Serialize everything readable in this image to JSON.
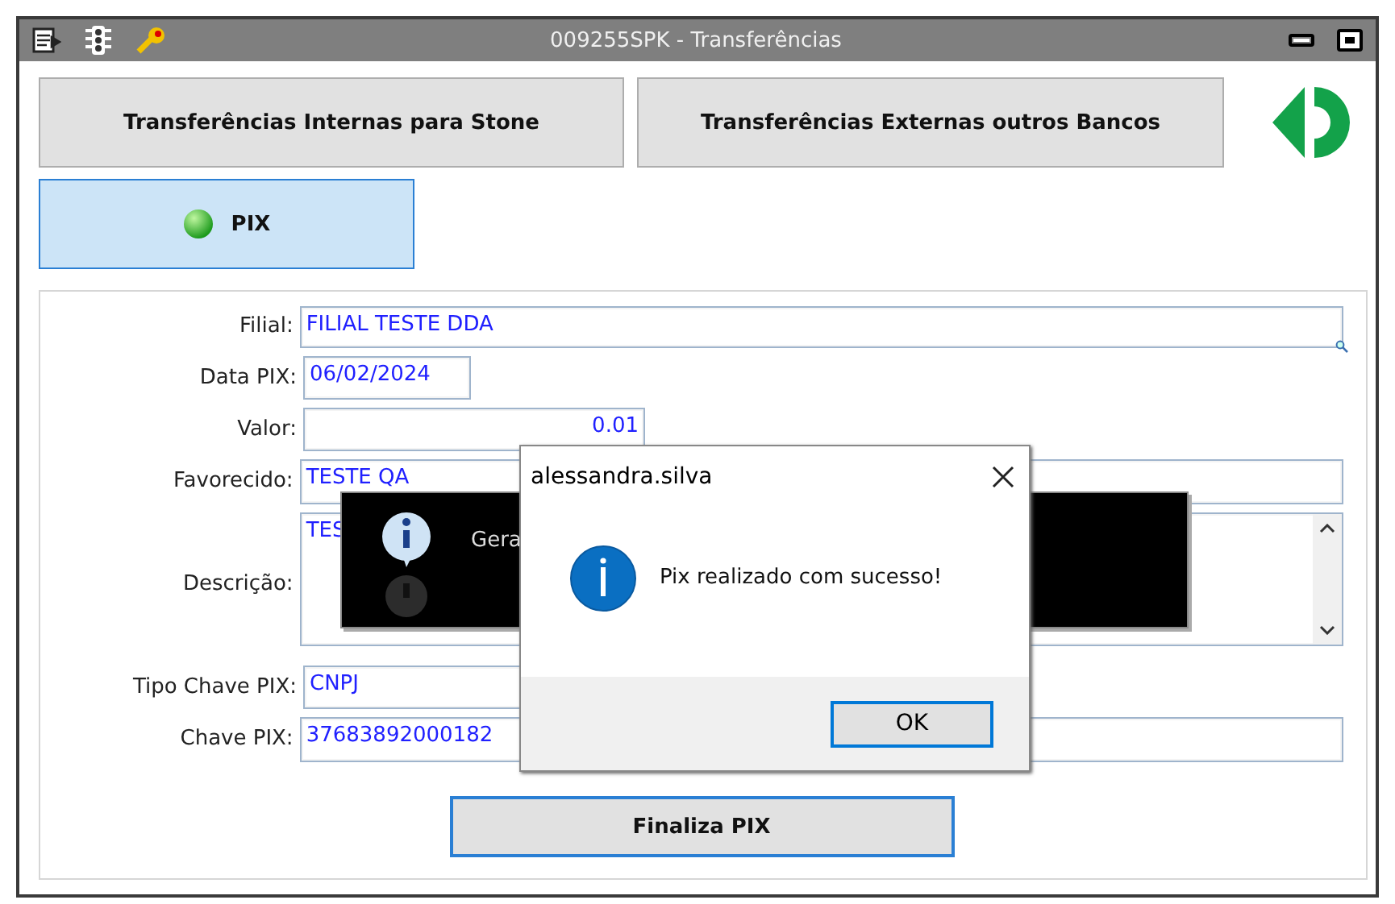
{
  "window": {
    "title": "009255SPK - Transferências"
  },
  "tabs": [
    {
      "label": "Transferências Internas para Stone",
      "selected": false
    },
    {
      "label": "Transferências Externas outros Bancos",
      "selected": false
    },
    {
      "label": "PIX",
      "selected": true
    }
  ],
  "form": {
    "fields": [
      {
        "label": "Filial:",
        "value": "FILIAL TESTE DDA",
        "kind": "lookup"
      },
      {
        "label": "Data PIX:",
        "value": "06/02/2024",
        "kind": "date"
      },
      {
        "label": "Valor:",
        "value": "0.01",
        "kind": "amount"
      },
      {
        "label": "Favorecido:",
        "value": "TESTE QA",
        "kind": "text"
      },
      {
        "label": "Descrição:",
        "value": "TES",
        "kind": "memo"
      },
      {
        "label": "Tipo Chave PIX:",
        "value": "CNPJ",
        "kind": "short"
      },
      {
        "label": "Chave PIX:",
        "value": "37683892000182",
        "kind": "text"
      }
    ]
  },
  "finalize_button": "Finaliza PIX",
  "toast": {
    "message": "Gera"
  },
  "dialog": {
    "title": "alessandra.silva",
    "message": "Pix realizado com sucesso!",
    "button": "OK"
  }
}
